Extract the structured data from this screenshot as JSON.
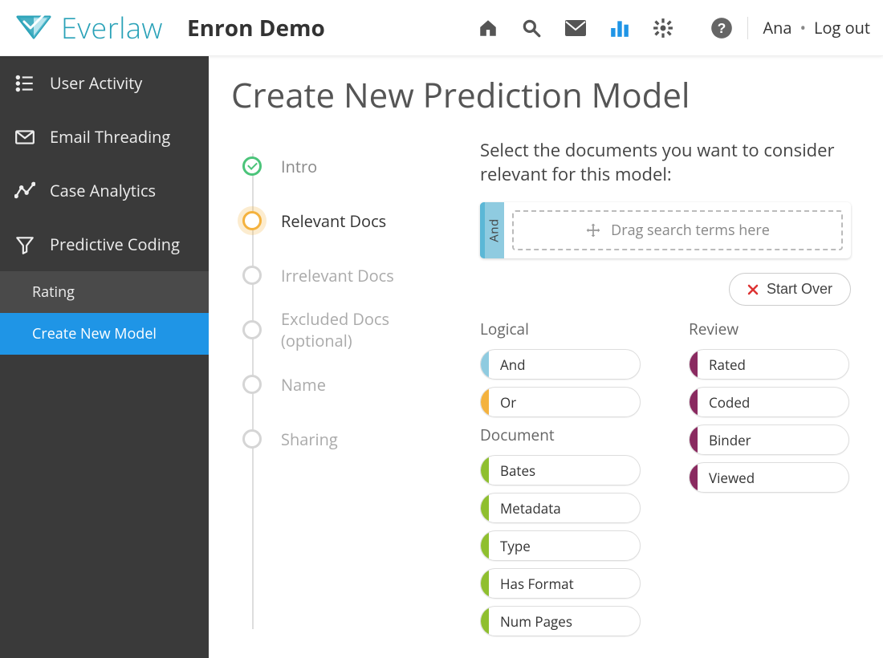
{
  "brand": {
    "name": "Everlaw"
  },
  "project": {
    "title": "Enron Demo"
  },
  "user": {
    "name": "Ana",
    "logout_label": "Log out"
  },
  "sidebar": {
    "items": [
      {
        "label": "User Activity"
      },
      {
        "label": "Email Threading"
      },
      {
        "label": "Case Analytics"
      },
      {
        "label": "Predictive Coding"
      }
    ],
    "sub": [
      {
        "label": "Rating"
      },
      {
        "label": "Create New Model"
      }
    ]
  },
  "page": {
    "title": "Create New Prediction Model"
  },
  "stepper": {
    "steps": [
      {
        "label": "Intro",
        "state": "done"
      },
      {
        "label": "Relevant Docs",
        "state": "current"
      },
      {
        "label": "Irrelevant Docs",
        "state": "pending"
      },
      {
        "label": "Excluded Docs (optional)",
        "state": "pending"
      },
      {
        "label": "Name",
        "state": "pending"
      },
      {
        "label": "Sharing",
        "state": "pending"
      }
    ]
  },
  "panel": {
    "prompt": "Select the documents you want to consider relevant for this model:",
    "drop_handle_label": "And",
    "drop_placeholder": "Drag search terms here",
    "start_over_label": "Start Over"
  },
  "term_groups": {
    "logical": {
      "title": "Logical",
      "items": [
        {
          "label": "And",
          "color": "blue"
        },
        {
          "label": "Or",
          "color": "yellow"
        }
      ]
    },
    "document": {
      "title": "Document",
      "items": [
        {
          "label": "Bates",
          "color": "green"
        },
        {
          "label": "Metadata",
          "color": "green"
        },
        {
          "label": "Type",
          "color": "green"
        },
        {
          "label": "Has Format",
          "color": "green"
        },
        {
          "label": "Num Pages",
          "color": "green"
        }
      ]
    },
    "review": {
      "title": "Review",
      "items": [
        {
          "label": "Rated",
          "color": "purple"
        },
        {
          "label": "Coded",
          "color": "purple"
        },
        {
          "label": "Binder",
          "color": "purple"
        },
        {
          "label": "Viewed",
          "color": "purple"
        }
      ]
    }
  },
  "colors": {
    "accent_teal": "#2aa2b8",
    "accent_blue": "#1f95e6",
    "step_done": "#4bc47a",
    "step_current": "#f4b23e",
    "pill_blue": "#8fcbe0",
    "pill_yellow": "#f4b23e",
    "pill_green": "#8fbf2f",
    "pill_purple": "#8a2a60"
  }
}
